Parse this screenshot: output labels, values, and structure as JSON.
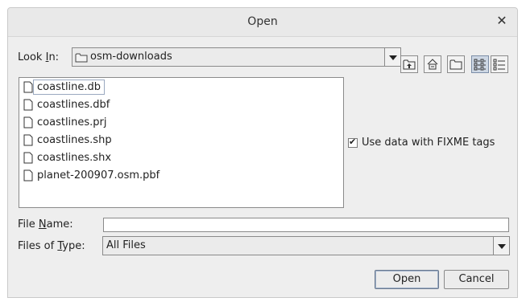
{
  "window": {
    "title": "Open"
  },
  "look_in": {
    "label_pre": "Look ",
    "label_mnemonic": "I",
    "label_post": "n:",
    "folder": "osm-downloads"
  },
  "toolbar": {
    "up": "up-one-level-icon",
    "home": "home-icon",
    "new_folder": "new-folder-icon",
    "list_view": "list-view-icon",
    "details_view": "details-view-icon"
  },
  "files": [
    {
      "name": "coastline.db"
    },
    {
      "name": "coastlines.dbf"
    },
    {
      "name": "coastlines.prj"
    },
    {
      "name": "coastlines.shp"
    },
    {
      "name": "coastlines.shx"
    },
    {
      "name": "planet-200907.osm.pbf"
    }
  ],
  "accessory": {
    "label": "Use data with FIXME tags",
    "checked": true
  },
  "file_name": {
    "label_pre": "File ",
    "label_mnemonic": "N",
    "label_post": "ame:",
    "value": ""
  },
  "file_type": {
    "label_pre": "Files of ",
    "label_mnemonic": "T",
    "label_post": "ype:",
    "value": "All Files"
  },
  "buttons": {
    "open": "Open",
    "cancel": "Cancel"
  }
}
